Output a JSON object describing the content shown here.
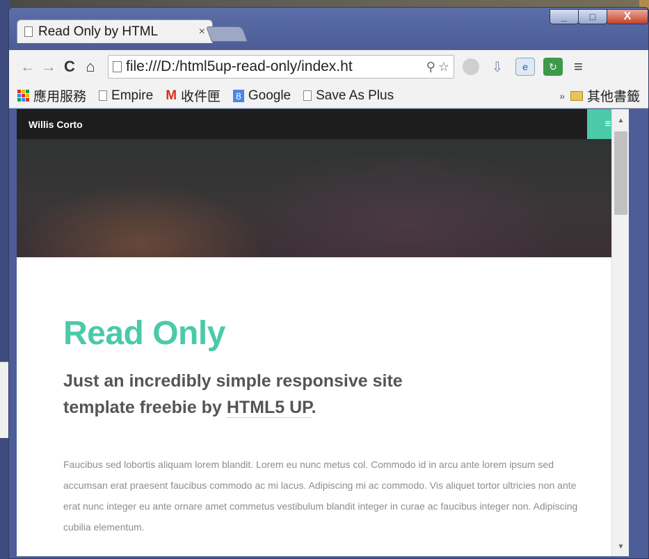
{
  "tab": {
    "title": "Read Only by HTML",
    "close_glyph": "×"
  },
  "window": {
    "minimize_glyph": "_",
    "maximize_glyph": "□",
    "close_glyph": "X"
  },
  "toolbar": {
    "url": "file:///D:/html5up-read-only/index.ht",
    "back_glyph": "←",
    "forward_glyph": "→",
    "reload_glyph": "C",
    "home_glyph": "⌂",
    "menu_glyph": "≡"
  },
  "bookmarks": {
    "items": [
      {
        "label": "應用服務",
        "icon": "apps-icon"
      },
      {
        "label": "Empire",
        "icon": "page-icon"
      },
      {
        "label": "收件匣",
        "icon": "gmail-icon"
      },
      {
        "label": "Google",
        "icon": "google-icon"
      },
      {
        "label": "Save As Plus",
        "icon": "page-icon"
      }
    ],
    "more_glyph": "»",
    "other_label": "其他書籤"
  },
  "site": {
    "brand": "Willis Corto",
    "menu_glyph": "≡",
    "title": "Read Only",
    "subtitle_prefix": "Just an incredibly simple responsive site template freebie by ",
    "subtitle_link": "HTML5 UP",
    "subtitle_suffix": ".",
    "paragraph": "Faucibus sed lobortis aliquam lorem blandit. Lorem eu nunc metus col. Commodo id in arcu ante lorem ipsum sed accumsan erat praesent faucibus commodo ac mi lacus. Adipiscing mi ac commodo. Vis aliquet tortor ultricies non ante erat nunc integer eu ante ornare amet commetus vestibulum blandit integer in curae ac faucibus integer non. Adipiscing cubilia elementum."
  },
  "colors": {
    "accent": "#4acaa8",
    "header_bg": "#1d1d1d"
  }
}
